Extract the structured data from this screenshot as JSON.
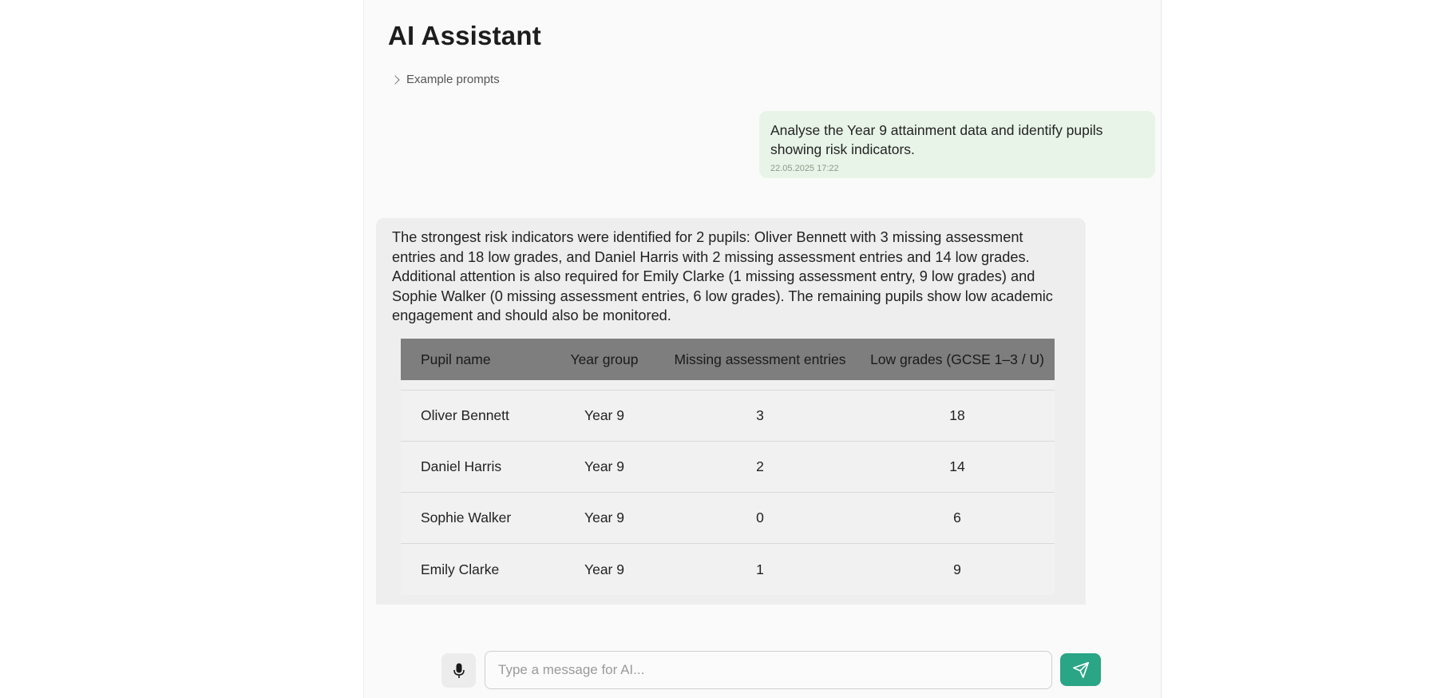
{
  "header": {
    "title": "AI Assistant",
    "example_prompts_label": "Example prompts"
  },
  "user_message": {
    "text": "Analyse the Year 9 attainment data and identify pupils showing risk indicators.",
    "timestamp": "22.05.2025 17:22"
  },
  "ai_message": {
    "text": "The strongest risk indicators were identified for 2 pupils: Oliver Bennett with 3 missing assessment entries and 18 low grades, and Daniel Harris with 2 missing assessment entries and 14 low grades. Additional attention is also required for Emily Clarke (1 missing assessment entry, 9 low grades) and Sophie Walker (0 missing assessment entries, 6 low grades). The remaining pupils show low academic engagement and should also be monitored.",
    "table": {
      "columns": [
        "Pupil name",
        "Year group",
        "Missing assessment entries",
        "Low grades (GCSE 1–3 / U)"
      ],
      "rows": [
        [
          "Oliver Bennett",
          "Year 9",
          "3",
          "18"
        ],
        [
          "Daniel Harris",
          "Year 9",
          "2",
          "14"
        ],
        [
          "Sophie Walker",
          "Year 9",
          "0",
          "6"
        ],
        [
          "Emily Clarke",
          "Year 9",
          "1",
          "9"
        ]
      ]
    }
  },
  "composer": {
    "placeholder": "Type a message for AI...",
    "mic_icon": "microphone-icon",
    "send_icon": "paper-plane-icon"
  },
  "colors": {
    "accent": "#2aa585",
    "user_bubble": "#e8f4e7",
    "ai_bubble": "#eeeeee",
    "table_header": "#7e7e7e"
  }
}
